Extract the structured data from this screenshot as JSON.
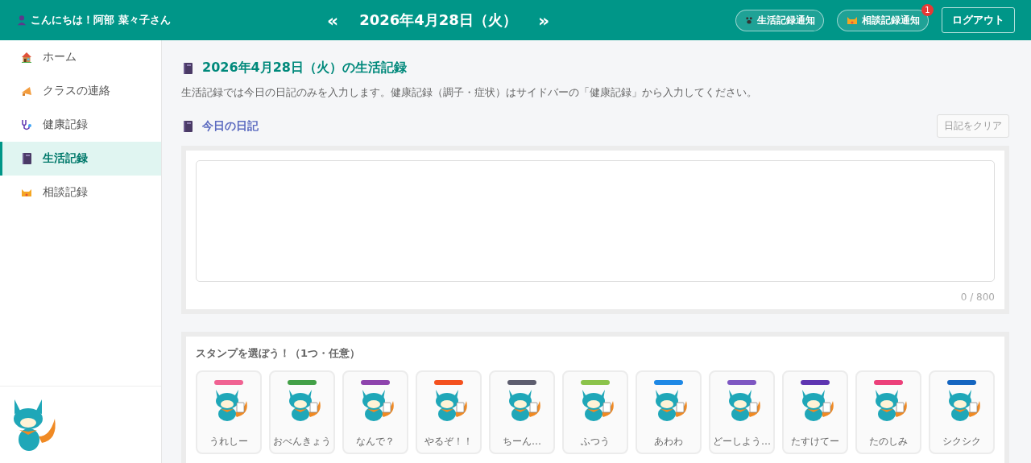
{
  "header": {
    "greeting": "こんにちは！阿部 菜々子さん",
    "prev": "«",
    "date": "2026年4月28日（火）",
    "next": "»",
    "notifications": [
      {
        "label": "生活記録通知"
      },
      {
        "label": "相談記録通知",
        "badge": "1"
      }
    ],
    "logout": "ログアウト"
  },
  "sidebar": {
    "items": [
      {
        "label": "ホーム",
        "selected": false
      },
      {
        "label": "クラスの連絡",
        "selected": false
      },
      {
        "label": "健康記録",
        "selected": false
      },
      {
        "label": "生活記録",
        "selected": true
      },
      {
        "label": "相談記録",
        "selected": false
      }
    ]
  },
  "page": {
    "title": "2026年4月28日（火）の生活記録",
    "description": "生活記録では今日の日記のみを入力します。健康記録（調子・症状）はサイドバーの「健康記録」から入力してください。"
  },
  "diary": {
    "heading": "今日の日記",
    "clear_button": "日記をクリア",
    "counter": "0 / 800"
  },
  "stamps": {
    "heading": "スタンプを選ぼう！（1つ・任意）",
    "items": [
      {
        "label": "うれしー",
        "selected": false
      },
      {
        "label": "おべんきょう",
        "selected": false
      },
      {
        "label": "なんで？",
        "selected": false
      },
      {
        "label": "やるぞ！！",
        "selected": false
      },
      {
        "label": "ちーん…",
        "selected": false
      },
      {
        "label": "ふつう",
        "selected": false
      },
      {
        "label": "あわわ",
        "selected": false
      },
      {
        "label": "どーしよう…",
        "selected": false
      },
      {
        "label": "たすけてー",
        "selected": false
      },
      {
        "label": "たのしみ",
        "selected": false
      },
      {
        "label": "シクシク",
        "selected": false
      }
    ]
  }
}
